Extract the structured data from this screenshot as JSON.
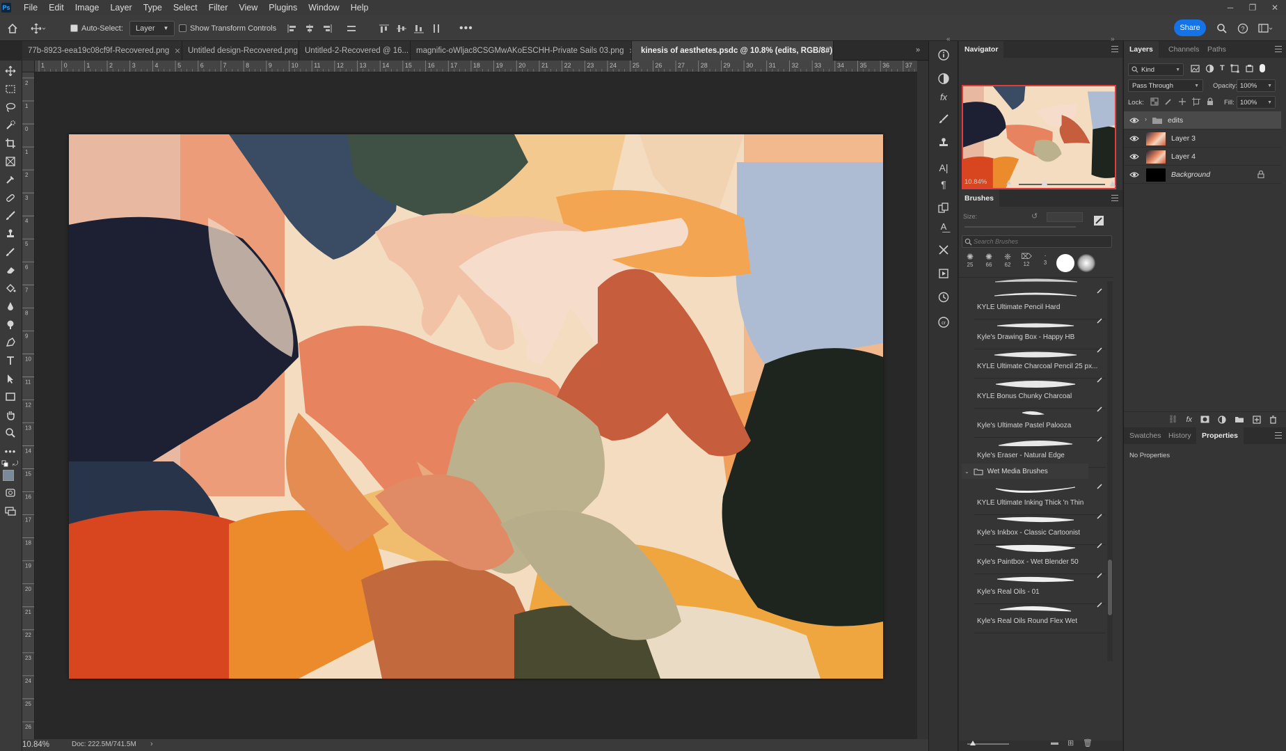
{
  "app": {
    "logo_text": "Ps"
  },
  "menu": [
    "File",
    "Edit",
    "Image",
    "Layer",
    "Type",
    "Select",
    "Filter",
    "View",
    "Plugins",
    "Window",
    "Help"
  ],
  "options_bar": {
    "auto_select_label": "Auto-Select:",
    "auto_select_checked": true,
    "auto_select_target": "Layer",
    "show_transform_label": "Show Transform Controls",
    "show_transform_checked": false,
    "share_label": "Share"
  },
  "tabs": [
    {
      "label": "77b-8923-eea19c08cf9f-Recovered.png",
      "active": false
    },
    {
      "label": "Untitled design-Recovered.png",
      "active": false
    },
    {
      "label": "Untitled-2-Recovered @ 16...",
      "active": false
    },
    {
      "label": "magnific-oWljac8CSGMwAKoESCHH-Private Sails 03.png",
      "active": false
    },
    {
      "label": "kinesis of aesthetes.psdc @ 10.8% (edits, RGB/8#)",
      "active": true
    }
  ],
  "ruler": {
    "h_ticks": [
      "1",
      "0",
      "1",
      "2",
      "3",
      "4",
      "5",
      "6",
      "7",
      "8",
      "9",
      "10",
      "11",
      "12",
      "13",
      "14",
      "15",
      "16",
      "17",
      "18",
      "19",
      "20",
      "21",
      "22",
      "23",
      "24",
      "25",
      "26",
      "27",
      "28",
      "29",
      "30",
      "31",
      "32",
      "33",
      "34",
      "35",
      "36",
      "37"
    ],
    "v_ticks": [
      "2",
      "1",
      "0",
      "1",
      "2",
      "3",
      "4",
      "5",
      "6",
      "7",
      "8",
      "9",
      "10",
      "11",
      "12",
      "13",
      "14",
      "15",
      "16",
      "17",
      "18",
      "19",
      "20",
      "21",
      "22",
      "23",
      "24",
      "25",
      "26"
    ]
  },
  "status": {
    "zoom": "10.84%",
    "doc": "Doc: 222.5M/741.5M"
  },
  "navigator": {
    "title": "Navigator",
    "zoom": "10.84%",
    "zoom_fraction": 0.3
  },
  "brushes": {
    "title": "Brushes",
    "size_label": "Size:",
    "search_placeholder": "Search Brushes",
    "recent_sizes": [
      "25",
      "66",
      "62",
      "12",
      "3"
    ],
    "items": [
      "KYLE Ultimate Pencil Hard",
      "Kyle's Drawing Box - Happy HB",
      "KYLE Ultimate Charcoal Pencil 25 px...",
      "KYLE Bonus Chunky Charcoal",
      "Kyle's Ultimate Pastel Palooza",
      "Kyle's Eraser - Natural Edge"
    ],
    "group_name": "Wet Media Brushes",
    "group_items": [
      "KYLE Ultimate Inking Thick 'n Thin",
      "Kyle's Inkbox - Classic Cartoonist",
      "Kyle's Paintbox - Wet Blender 50",
      "Kyle's Real Oils - 01",
      "Kyle's Real Oils Round Flex Wet"
    ]
  },
  "layers_panel": {
    "tabs": [
      "Layers",
      "Channels",
      "Paths"
    ],
    "filter_label": "Kind",
    "blend_mode": "Pass Through",
    "opacity_label": "Opacity:",
    "opacity_value": "100%",
    "lock_label": "Lock:",
    "fill_label": "Fill:",
    "fill_value": "100%",
    "layers": [
      {
        "name": "edits",
        "type": "group",
        "selected": true
      },
      {
        "name": "Layer 3",
        "type": "image",
        "selected": false
      },
      {
        "name": "Layer 4",
        "type": "image",
        "selected": false
      },
      {
        "name": "Background",
        "type": "background",
        "selected": false
      }
    ]
  },
  "properties_panel": {
    "tabs": [
      "Swatches",
      "History",
      "Properties"
    ],
    "message": "No Properties"
  },
  "colors": {
    "accent": "#1473e6",
    "foreground_swatch": "#7a8a9a",
    "background_swatch": "#ffffff"
  }
}
